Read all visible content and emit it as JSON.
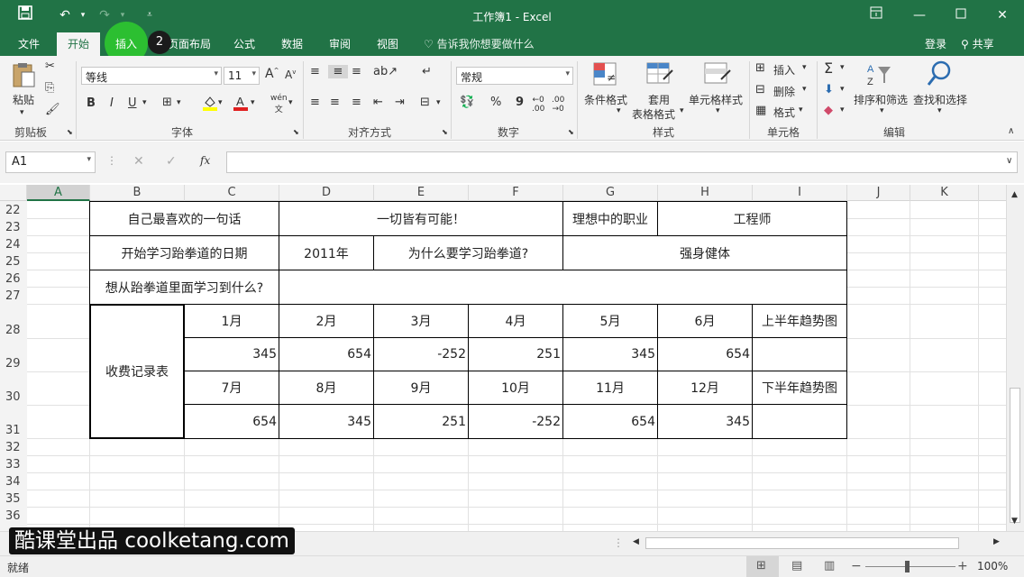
{
  "window": {
    "title": "工作簿1 - Excel"
  },
  "menu_tabs": [
    "文件",
    "开始",
    "插入",
    "页面布局",
    "公式",
    "数据",
    "审阅",
    "视图"
  ],
  "tell_me": "告诉我你想要做什么",
  "login": "登录",
  "share": "共享",
  "step_badge": "2",
  "ribbon": {
    "paste": "粘贴",
    "clipboard": "剪贴板",
    "font_name": "等线",
    "font_size": "11",
    "bold": "B",
    "italic": "I",
    "underline": "U",
    "wen": "wén",
    "font_group": "字体",
    "align_group": "对齐方式",
    "number_format": "常规",
    "percent": "%",
    "comma": "9",
    "number_group": "数字",
    "cond_format": "条件格式",
    "table_format_1": "套用",
    "table_format_2": "表格格式",
    "cell_style": "单元格样式",
    "styles_group": "样式",
    "insert": "插入",
    "delete": "删除",
    "format": "格式",
    "cells_group": "单元格",
    "sort_filter": "排序和筛选",
    "find_select": "查找和选择",
    "edit_group": "编辑"
  },
  "formula_bar": {
    "name_box": "A1",
    "fx": "fx",
    "value": ""
  },
  "columns": [
    "A",
    "B",
    "C",
    "D",
    "E",
    "F",
    "G",
    "H",
    "I",
    "J",
    "K"
  ],
  "rows": [
    "22",
    "23",
    "24",
    "25",
    "26",
    "27",
    "28",
    "29",
    "30",
    "31",
    "32",
    "33",
    "34",
    "35",
    "36"
  ],
  "sheet": {
    "favorite_quote_label": "自己最喜欢的一句话",
    "favorite_quote": "一切皆有可能！",
    "ideal_job_label": "理想中的职业",
    "ideal_job": "工程师",
    "start_date_label": "开始学习跆拳道的日期",
    "start_date": "2011年",
    "why_label": "为什么要学习跆拳道?",
    "why": "强身健体",
    "learn_label": "想从跆拳道里面学习到什么?",
    "learn": "",
    "fee_label": "收费记录表",
    "h1_months": [
      "1月",
      "2月",
      "3月",
      "4月",
      "5月",
      "6月"
    ],
    "h1_values": [
      "345",
      "654",
      "-252",
      "251",
      "345",
      "654"
    ],
    "h1_trend": "上半年趋势图",
    "h2_months": [
      "7月",
      "8月",
      "9月",
      "10月",
      "11月",
      "12月"
    ],
    "h2_values": [
      "654",
      "345",
      "251",
      "-252",
      "654",
      "345"
    ],
    "h2_trend": "下半年趋势图"
  },
  "status": {
    "ready": "就绪",
    "zoom": "100%"
  },
  "watermark": "酷课堂出品 coolketang.com"
}
